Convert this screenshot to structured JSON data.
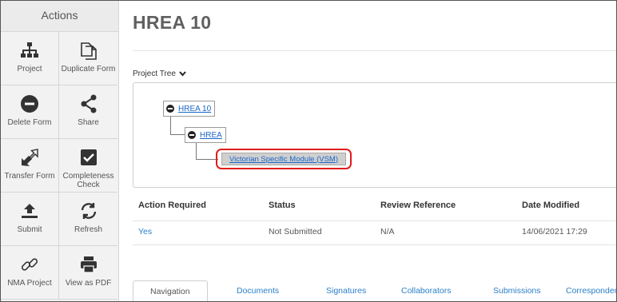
{
  "sidebar": {
    "header": "Actions",
    "items": [
      {
        "label": "Project",
        "icon": "sitemap-icon"
      },
      {
        "label": "Duplicate Form",
        "icon": "copy-icon"
      },
      {
        "label": "Delete Form",
        "icon": "minus-circle-icon"
      },
      {
        "label": "Share",
        "icon": "share-icon"
      },
      {
        "label": "Transfer Form",
        "icon": "transfer-icon"
      },
      {
        "label": "Completeness Check",
        "icon": "checkbox-icon"
      },
      {
        "label": "Submit",
        "icon": "upload-icon"
      },
      {
        "label": "Refresh",
        "icon": "refresh-icon"
      },
      {
        "label": "NMA Project",
        "icon": "link-icon"
      },
      {
        "label": "View as PDF",
        "icon": "printer-icon"
      }
    ]
  },
  "page": {
    "title": "HREA 10",
    "project_tree_label": "Project Tree"
  },
  "tree": {
    "root": "HREA 10",
    "child": "HREA",
    "leaf": "Victorian Specific Module (VSM)"
  },
  "table": {
    "headers": [
      "Action Required",
      "Status",
      "Review Reference",
      "Date Modified"
    ],
    "row": [
      "Yes",
      "Not Submitted",
      "N/A",
      "14/06/2021 17:29"
    ]
  },
  "tabs": [
    "Navigation",
    "Documents",
    "Signatures",
    "Collaborators",
    "Submissions",
    "Correspondence"
  ],
  "colors": {
    "link": "#1a66c9",
    "highlight_border": "#e01d1d"
  }
}
